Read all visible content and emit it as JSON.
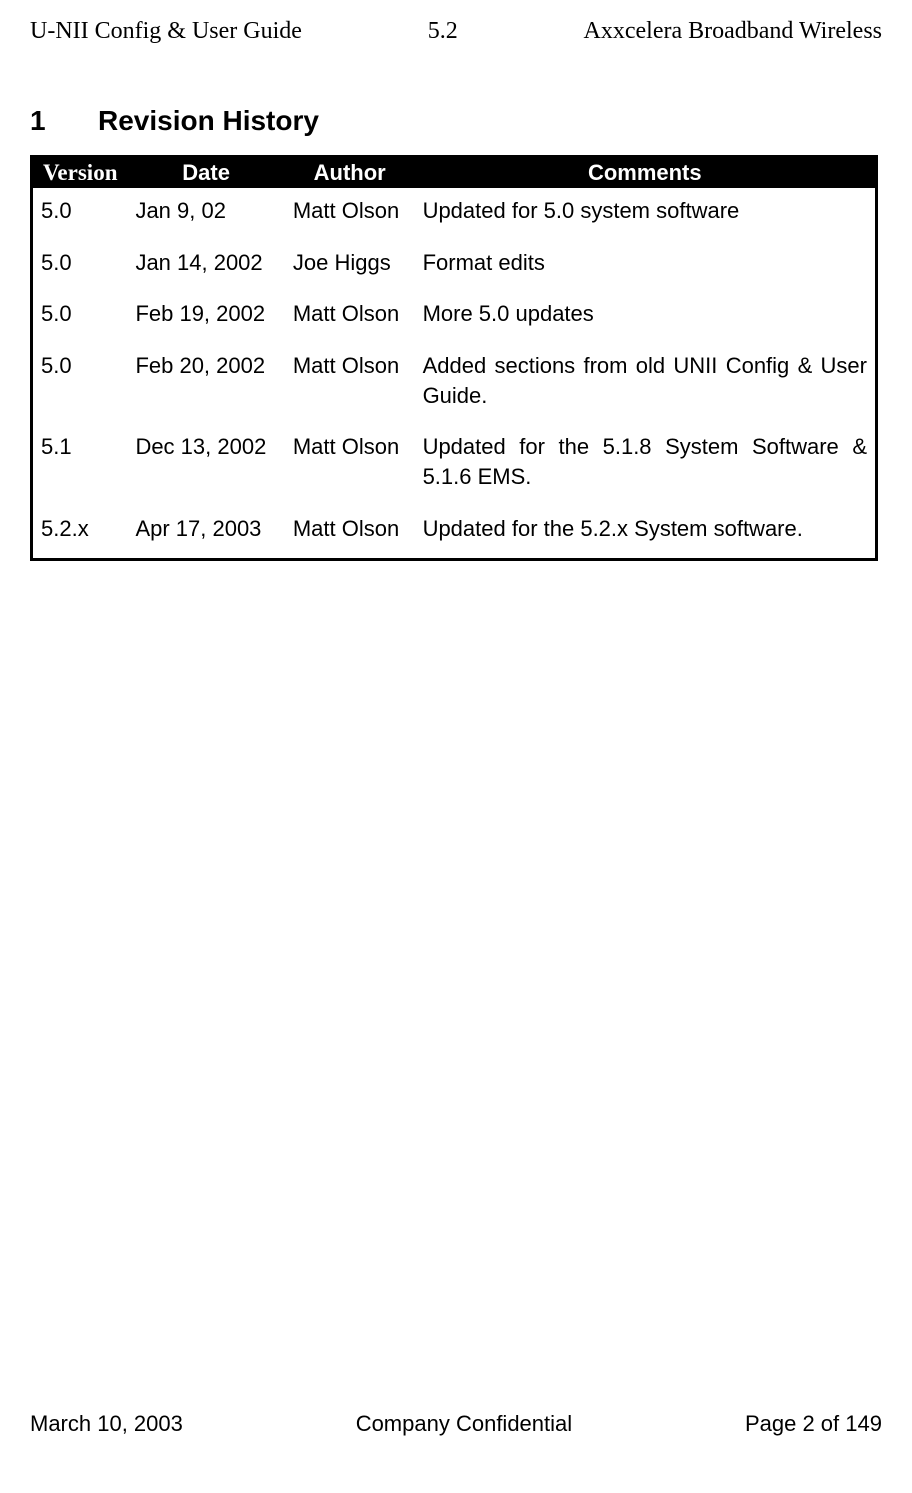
{
  "header": {
    "left": "U-NII Config & User Guide",
    "center": "5.2",
    "right": "Axxcelera Broadband Wireless"
  },
  "section": {
    "number": "1",
    "title": "Revision History"
  },
  "table": {
    "headers": {
      "version": "Version",
      "date": "Date",
      "author": "Author",
      "comments": "Comments"
    },
    "rows": [
      {
        "version": "5.0",
        "date": "Jan 9, 02",
        "author": "Matt Olson",
        "comments": "Updated for 5.0 system software",
        "justify": false
      },
      {
        "version": " 5.0",
        "date": "Jan 14, 2002",
        "author": "Joe Higgs",
        "comments": "Format edits",
        "justify": false
      },
      {
        "version": "5.0",
        "date": "Feb 19, 2002",
        "author": "Matt Olson",
        "comments": "More 5.0 updates",
        "justify": false
      },
      {
        "version": "5.0",
        "date": "Feb 20, 2002",
        "author": "Matt Olson",
        "comments": "Added sections from old UNII Config & User Guide.",
        "justify": true
      },
      {
        "version": "5.1",
        "date": "Dec 13, 2002",
        "author": "Matt Olson",
        "comments": "Updated for the 5.1.8 System Software & 5.1.6 EMS.",
        "justify": true
      },
      {
        "version": "5.2.x",
        "date": "Apr 17, 2003",
        "author": "Matt Olson",
        "comments": "Updated for the 5.2.x System software.",
        "justify": true
      }
    ]
  },
  "footer": {
    "left": "March 10, 2003",
    "center": "Company Confidential",
    "right": "Page 2 of 149"
  }
}
